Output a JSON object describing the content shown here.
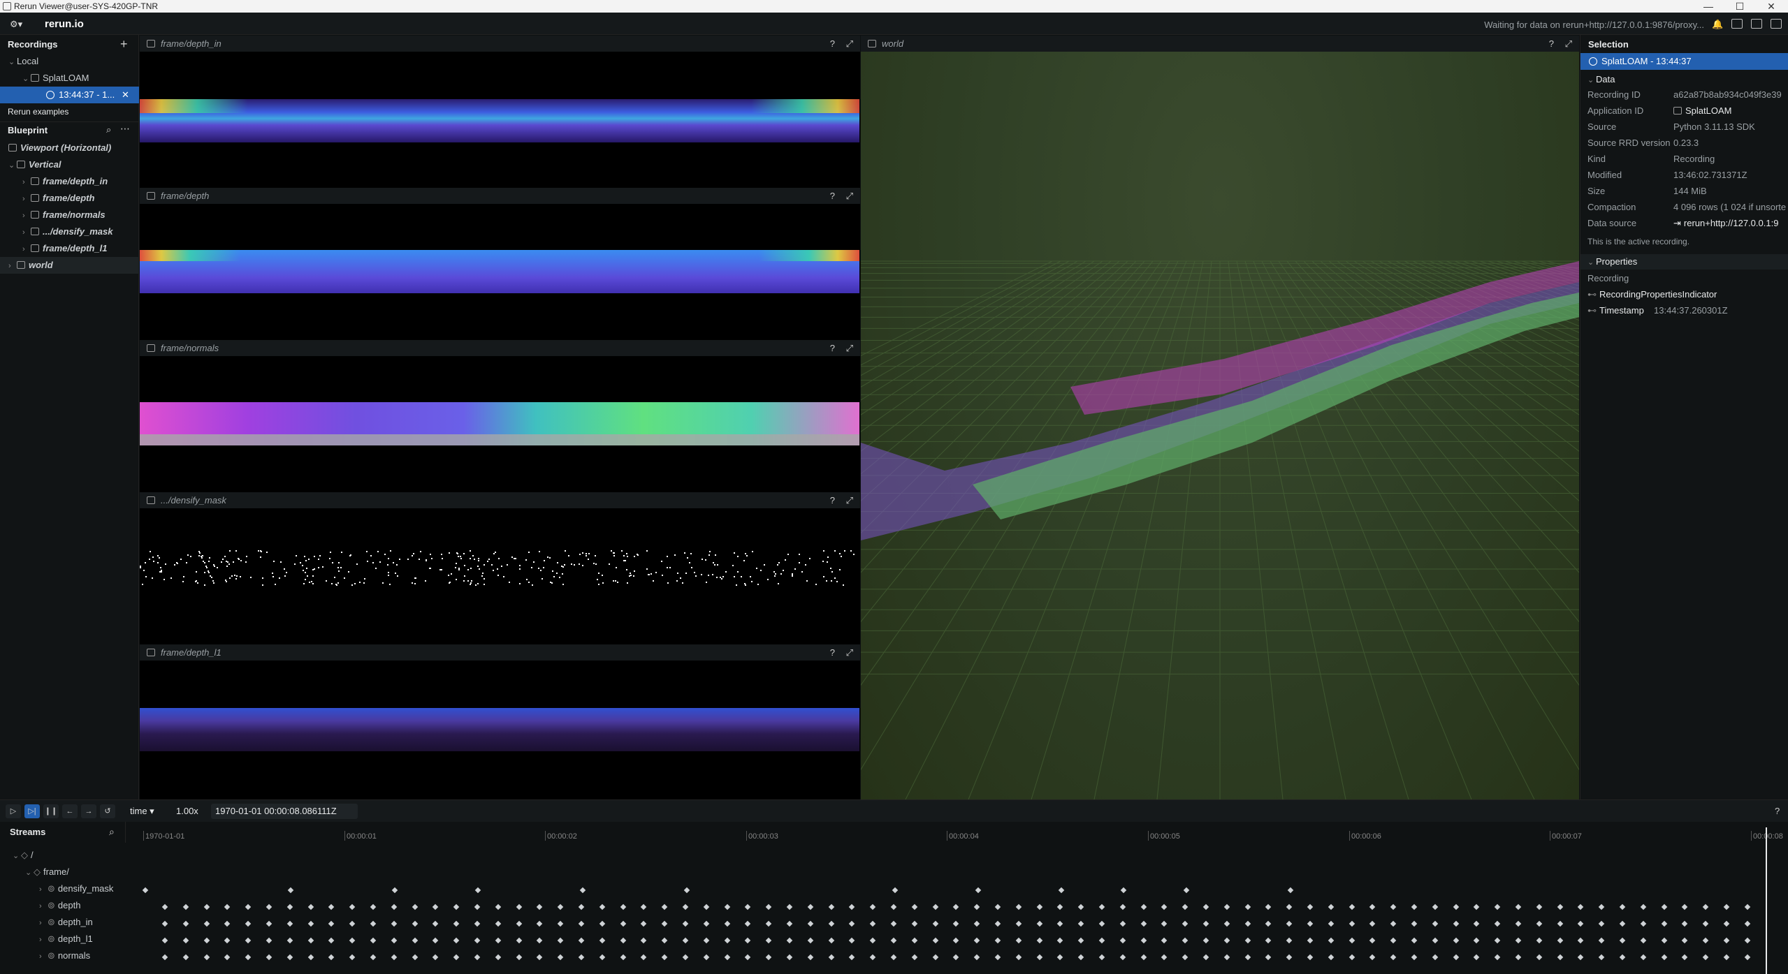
{
  "window": {
    "title": "Rerun Viewer@user-SYS-420GP-TNR"
  },
  "topbar": {
    "logo": "rerun.io",
    "status": "Waiting for data on rerun+http://127.0.0.1:9876/proxy..."
  },
  "left": {
    "recordings_header": "Recordings",
    "local_label": "Local",
    "app_label": "SplatLOAM",
    "recording_label": "13:44:37 - 1...",
    "examples_label": "Rerun examples",
    "blueprint_header": "Blueprint",
    "blueprint_items": [
      {
        "label": "Viewport (Horizontal)"
      },
      {
        "label": "Vertical"
      },
      {
        "label": "frame/depth_in"
      },
      {
        "label": "frame/depth"
      },
      {
        "label": "frame/normals"
      },
      {
        "label": ".../densify_mask"
      },
      {
        "label": "frame/depth_l1"
      },
      {
        "label": "world"
      }
    ]
  },
  "views": [
    {
      "title": "frame/depth_in"
    },
    {
      "title": "frame/depth"
    },
    {
      "title": "frame/normals"
    },
    {
      "title": ".../densify_mask"
    },
    {
      "title": "frame/depth_l1"
    }
  ],
  "world_view": {
    "title": "world"
  },
  "view_help": "?",
  "view_expand": "⤢",
  "selection": {
    "header": "Selection",
    "selected": "SplatLOAM - 13:44:37",
    "data_header": "Data",
    "rows": [
      {
        "key": "Recording ID",
        "value": "a62a87b8ab934c049f3e39"
      },
      {
        "key": "Application ID",
        "value": "SplatLOAM"
      },
      {
        "key": "Source",
        "value": "Python 3.11.13 SDK"
      },
      {
        "key": "Source RRD version",
        "value": "0.23.3"
      },
      {
        "key": "Kind",
        "value": "Recording"
      },
      {
        "key": "Modified",
        "value": "13:46:02.731371Z"
      },
      {
        "key": "Size",
        "value": "144 MiB"
      },
      {
        "key": "Compaction",
        "value": "4 096 rows (1 024 if unsorte"
      },
      {
        "key": "Data source",
        "value": "rerun+http://127.0.0.1:9"
      }
    ],
    "active_note": "This is the active recording.",
    "properties_header": "Properties",
    "recording_label": "Recording",
    "props": [
      {
        "key": "RecordingPropertiesIndicator",
        "value": ""
      },
      {
        "key": "Timestamp",
        "value": "13:44:37.260301Z"
      }
    ]
  },
  "timeline": {
    "timeline_name": "time",
    "speed": "1.00x",
    "current_time": "1970-01-01 00:00:08.086111Z",
    "help": "?",
    "ticks": [
      "1970-01-01",
      "00:00:01",
      "00:00:02",
      "00:00:03",
      "00:00:04",
      "00:00:05",
      "00:00:06",
      "00:00:07",
      "00:00:08"
    ]
  },
  "streams": {
    "header": "Streams",
    "root": "/",
    "frame": "frame/",
    "items": [
      "densify_mask",
      "depth",
      "depth_in",
      "depth_l1",
      "normals"
    ]
  },
  "colors": {
    "accent": "#2360b0",
    "bg": "#0d1011",
    "panel": "#111415"
  }
}
